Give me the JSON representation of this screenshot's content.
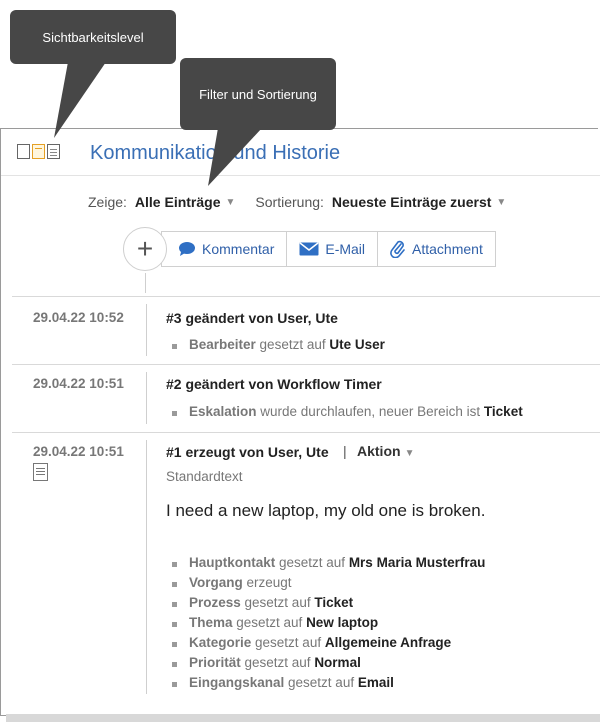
{
  "tooltips": {
    "visibility": "Sichtbarkeitslevel",
    "filter": "Filter und Sortierung"
  },
  "header": {
    "title": "Kommunikation und Historie"
  },
  "filter": {
    "show_label": "Zeige:",
    "show_value": "Alle Einträge",
    "sort_label": "Sortierung:",
    "sort_value": "Neueste Einträge zuerst"
  },
  "actions": {
    "add_symbol": "+",
    "comment": "Kommentar",
    "email": "E-Mail",
    "attachment": "Attachment"
  },
  "entries": [
    {
      "date": "29.04.22 10:52",
      "title": "#3 geändert von User, Ute",
      "items": [
        {
          "key": "Bearbeiter",
          "mid": " gesetzt auf ",
          "value": "Ute User"
        }
      ]
    },
    {
      "date": "29.04.22 10:51",
      "title": "#2 geändert von Workflow Timer",
      "items": [
        {
          "key": "Eskalation",
          "mid": " wurde durchlaufen, neuer Bereich ist ",
          "value": "Ticket"
        }
      ]
    },
    {
      "date": "29.04.22 10:51",
      "title": "#1 erzeugt von User, Ute",
      "pipe": "|",
      "action": "Aktion",
      "subtitle": "Standardtext",
      "message": "I need a new laptop, my old one is broken.",
      "items": [
        {
          "key": "Hauptkontakt",
          "mid": " gesetzt auf ",
          "value": "Mrs Maria Musterfrau"
        },
        {
          "key": "Vorgang",
          "mid": " erzeugt",
          "value": ""
        },
        {
          "key": "Prozess",
          "mid": " gesetzt auf ",
          "value": "Ticket"
        },
        {
          "key": "Thema",
          "mid": " gesetzt auf ",
          "value": "New laptop"
        },
        {
          "key": "Kategorie",
          "mid": " gesetzt auf ",
          "value": "Allgemeine Anfrage"
        },
        {
          "key": "Priorität",
          "mid": " gesetzt auf ",
          "value": "Normal"
        },
        {
          "key": "Eingangskanal",
          "mid": " gesetzt auf ",
          "value": "Email"
        }
      ]
    }
  ],
  "colors": {
    "accent": "#3a6fb5",
    "tooltip_bg": "#474747",
    "active_visibility": "#e5a024"
  }
}
